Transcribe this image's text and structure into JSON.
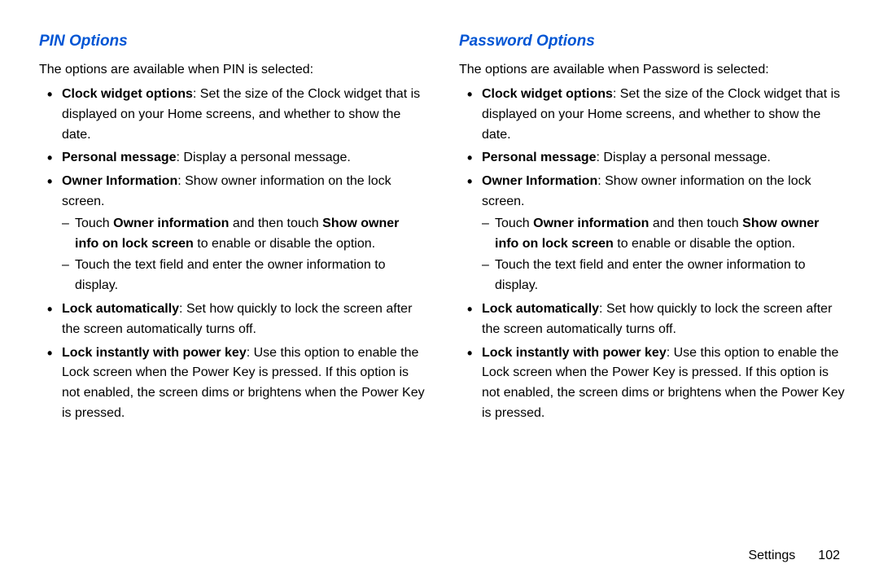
{
  "left": {
    "heading": "PIN Options",
    "intro": "The options are available when PIN is selected:",
    "items": [
      {
        "bold": "Clock widget options",
        "rest": ": Set the size of the Clock widget that is displayed on your Home screens, and whether to show the date."
      },
      {
        "bold": "Personal message",
        "rest": ": Display a personal message."
      },
      {
        "bold": "Owner Information",
        "rest": ": Show owner information on the lock screen.",
        "sub": [
          {
            "pre": "Touch ",
            "b1": "Owner information",
            "mid": " and then touch ",
            "b2": "Show owner info on lock screen",
            "post": " to enable or disable the option."
          },
          {
            "pre": "Touch the text field and enter the owner information to display."
          }
        ]
      },
      {
        "bold": "Lock automatically",
        "rest": ": Set how quickly to lock the screen after the screen automatically turns off."
      },
      {
        "bold": "Lock instantly with power key",
        "rest": ": Use this option to enable the Lock screen when the Power Key is pressed. If this option is not enabled, the screen dims or brightens when the Power Key is pressed."
      }
    ]
  },
  "right": {
    "heading": "Password Options",
    "intro": "The options are available when Password is selected:",
    "items": [
      {
        "bold": "Clock widget options",
        "rest": ": Set the size of the Clock widget that is displayed on your Home screens, and whether to show the date."
      },
      {
        "bold": "Personal message",
        "rest": ": Display a personal message."
      },
      {
        "bold": "Owner Information",
        "rest": ": Show owner information on the lock screen.",
        "sub": [
          {
            "pre": "Touch ",
            "b1": "Owner information",
            "mid": " and then touch ",
            "b2": "Show owner info on lock screen",
            "post": " to enable or disable the option."
          },
          {
            "pre": "Touch the text field and enter the owner information to display."
          }
        ]
      },
      {
        "bold": "Lock automatically",
        "rest": ": Set how quickly to lock the screen after the screen automatically turns off."
      },
      {
        "bold": "Lock instantly with power key",
        "rest": ": Use this option to enable the Lock screen when the Power Key is pressed. If this option is not enabled, the screen dims or brightens when the Power Key is pressed."
      }
    ]
  },
  "footer": {
    "section": "Settings",
    "page": "102"
  }
}
